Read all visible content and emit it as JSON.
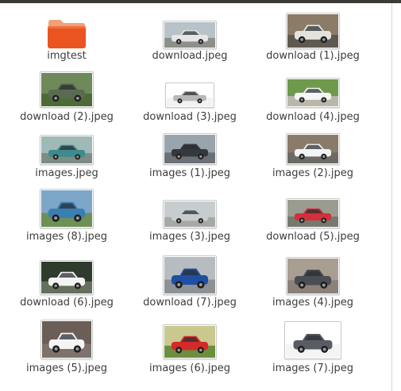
{
  "window": {
    "top_bar_color": "#3c3b37"
  },
  "files": [
    {
      "name": "imgtest",
      "kind": "folder",
      "icon": "folder-icon",
      "colors": {
        "bg": "#e95420",
        "tab": "#f0a277"
      }
    },
    {
      "name": "download.jpeg",
      "kind": "image",
      "icon": "car-thumbnail",
      "colors": {
        "sky": "#b7c3c9",
        "ground": "#8d8f8a",
        "car": "#e6e6e4"
      }
    },
    {
      "name": "download (1).jpeg",
      "kind": "image",
      "icon": "car-thumbnail",
      "colors": {
        "sky": "#8c7b66",
        "ground": "#5f5a50",
        "car": "#e4e2dc"
      }
    },
    {
      "name": "download (2).jpeg",
      "kind": "image",
      "icon": "car-thumbnail",
      "colors": {
        "sky": "#6e8a5a",
        "ground": "#4d6b37",
        "car": "#5b6a52"
      }
    },
    {
      "name": "download (3).jpeg",
      "kind": "image",
      "icon": "car-thumbnail",
      "colors": {
        "sky": "#ffffff",
        "ground": "#f2f2f2",
        "car": "#b8b8b8"
      }
    },
    {
      "name": "download (4).jpeg",
      "kind": "image",
      "icon": "car-thumbnail",
      "colors": {
        "sky": "#6f9a4c",
        "ground": "#b9b7aa",
        "car": "#f5f5f5"
      }
    },
    {
      "name": "images.jpeg",
      "kind": "image",
      "icon": "car-thumbnail",
      "colors": {
        "sky": "#9fb9b6",
        "ground": "#7e8c86",
        "car": "#3f8a8c"
      }
    },
    {
      "name": "images (1).jpeg",
      "kind": "image",
      "icon": "car-thumbnail",
      "colors": {
        "sky": "#9aa4ad",
        "ground": "#6b7177",
        "car": "#35393e"
      }
    },
    {
      "name": "images (2).jpeg",
      "kind": "image",
      "icon": "car-thumbnail",
      "colors": {
        "sky": "#8a7a6a",
        "ground": "#6d6a66",
        "car": "#f3f3f3"
      }
    },
    {
      "name": "images (8).jpeg",
      "kind": "image",
      "icon": "car-thumbnail",
      "colors": {
        "sky": "#7ea6c8",
        "ground": "#6e8f55",
        "car": "#3a7fb4"
      }
    },
    {
      "name": "images (3).jpeg",
      "kind": "image",
      "icon": "car-thumbnail",
      "colors": {
        "sky": "#c7cccf",
        "ground": "#a7a9a7",
        "car": "#c9cccd"
      }
    },
    {
      "name": "download (5).jpeg",
      "kind": "image",
      "icon": "car-thumbnail",
      "colors": {
        "sky": "#9a9c8f",
        "ground": "#77786f",
        "car": "#d2303a"
      }
    },
    {
      "name": "download (6).jpeg",
      "kind": "image",
      "icon": "car-thumbnail",
      "colors": {
        "sky": "#2f3b2c",
        "ground": "#64705d",
        "car": "#f4f4f4"
      }
    },
    {
      "name": "download (7).jpeg",
      "kind": "image",
      "icon": "car-thumbnail",
      "colors": {
        "sky": "#b7bcc0",
        "ground": "#8e9296",
        "car": "#1e4fa2"
      }
    },
    {
      "name": "images (4).jpeg",
      "kind": "image",
      "icon": "car-thumbnail",
      "colors": {
        "sky": "#a99e92",
        "ground": "#8a8278",
        "car": "#4a4e54"
      }
    },
    {
      "name": "images (5).jpeg",
      "kind": "image",
      "icon": "car-thumbnail",
      "colors": {
        "sky": "#6b5e56",
        "ground": "#7d726c",
        "car": "#f4f4f4"
      }
    },
    {
      "name": "images (6).jpeg",
      "kind": "image",
      "icon": "car-thumbnail",
      "colors": {
        "sky": "#c9c88f",
        "ground": "#6b8f3e",
        "car": "#d52a2a"
      }
    },
    {
      "name": "images (7).jpeg",
      "kind": "image",
      "icon": "car-thumbnail",
      "colors": {
        "sky": "#ffffff",
        "ground": "#f4f4f4",
        "car": "#585d63"
      }
    }
  ]
}
